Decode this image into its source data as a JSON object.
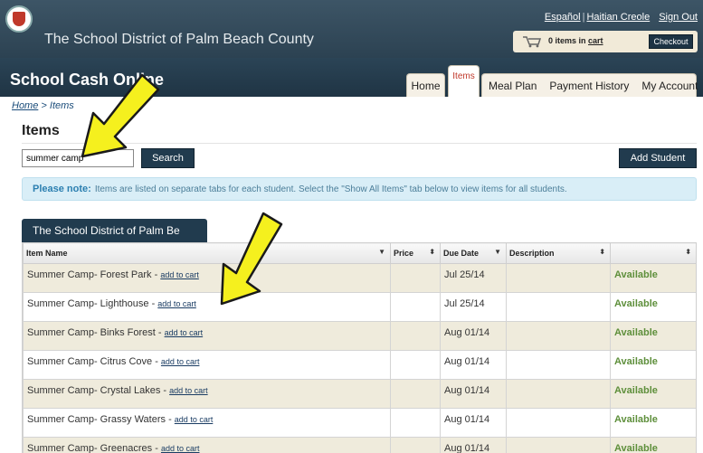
{
  "header": {
    "district_title": "The School District of Palm Beach County",
    "links": {
      "espanol": "Español",
      "haitian_creole": "Haitian Creole",
      "sign_out": "Sign Out"
    },
    "cart": {
      "count_text": "0 items in",
      "cart_link": "cart",
      "checkout": "Checkout"
    }
  },
  "app_title": "School Cash Online",
  "tabs": {
    "home": "Home",
    "items": "Items",
    "meal_plan": "Meal Plan",
    "payment_history": "Payment History",
    "my_account": "My Account"
  },
  "breadcrumb": {
    "home": "Home",
    "separator": " > ",
    "current": "Items"
  },
  "page_title": "Items",
  "search": {
    "value": "summer camp",
    "button": "Search"
  },
  "add_student": "Add Student",
  "note": {
    "label": "Please note:",
    "text": "Items are listed on separate tabs for each student. Select the \"Show All Items\" tab below to view items for all students."
  },
  "student_tab": "The School District of Palm Be",
  "table": {
    "headers": {
      "name": "Item Name",
      "price": "Price",
      "due": "Due Date",
      "description": "Description",
      "status": ""
    },
    "add_to_cart": "add to cart",
    "rows": [
      {
        "name": "Summer Camp- Forest Park",
        "price": "",
        "due": "Jul 25/14",
        "description": "",
        "status": "Available"
      },
      {
        "name": "Summer Camp- Lighthouse",
        "price": "",
        "due": "Jul 25/14",
        "description": "",
        "status": "Available"
      },
      {
        "name": "Summer Camp- Binks Forest",
        "price": "",
        "due": "Aug 01/14",
        "description": "",
        "status": "Available"
      },
      {
        "name": "Summer Camp- Citrus Cove",
        "price": "",
        "due": "Aug 01/14",
        "description": "",
        "status": "Available"
      },
      {
        "name": "Summer Camp- Crystal Lakes",
        "price": "",
        "due": "Aug 01/14",
        "description": "",
        "status": "Available"
      },
      {
        "name": "Summer Camp- Grassy Waters",
        "price": "",
        "due": "Aug 01/14",
        "description": "",
        "status": "Available"
      },
      {
        "name": "Summer Camp- Greenacres",
        "price": "",
        "due": "Aug 01/14",
        "description": "",
        "status": "Available"
      }
    ]
  },
  "colors": {
    "header_dark": "#2c4252",
    "button_dark": "#213b4e",
    "row_tan": "#efebdc",
    "available_green": "#5e8f3b",
    "arrow_yellow": "#f5f01e"
  }
}
